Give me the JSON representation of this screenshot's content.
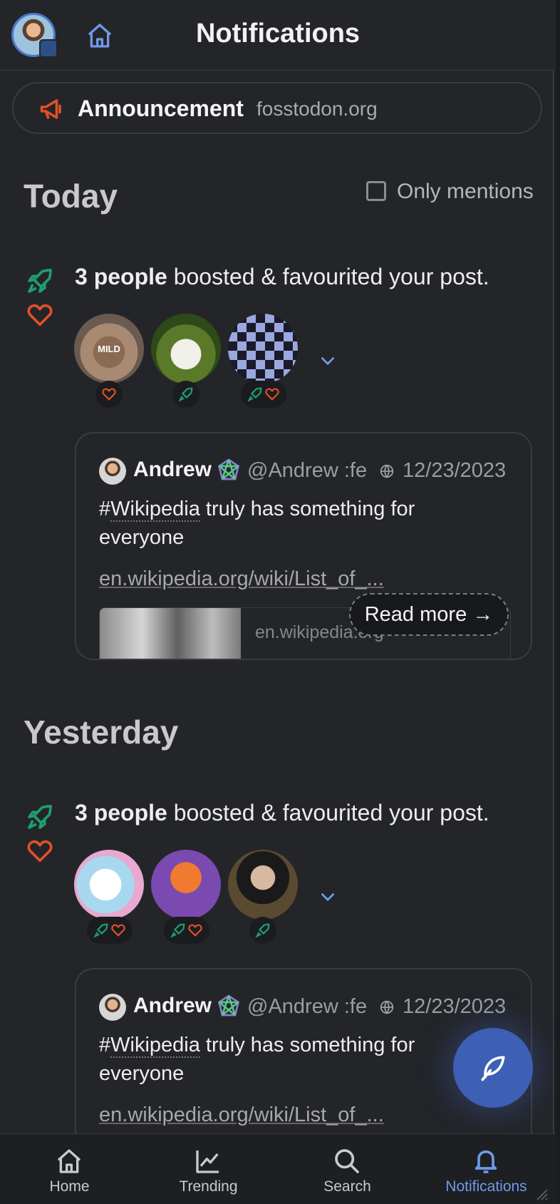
{
  "header": {
    "title": "Notifications"
  },
  "announcement": {
    "label": "Announcement",
    "domain": "fosstodon.org"
  },
  "sections": [
    {
      "heading": "Today",
      "filter_label": "Only mentions",
      "notification": {
        "count_bold": "3 people",
        "text": " boosted & favourited your post.",
        "post": {
          "author": "Andrew",
          "handle": "@Andrew :fe",
          "date": "12/23/2023",
          "body_hash": "#",
          "body_tag": "Wikipedia",
          "body_rest": " truly has something for everyone",
          "link": "en.wikipedia.org/wiki/List_of_...",
          "preview_domain": "en.wikipedia.org",
          "read_more": "Read more →"
        }
      }
    },
    {
      "heading": "Yesterday",
      "notification": {
        "count_bold": "3 people",
        "text": " boosted & favourited your post.",
        "post": {
          "author": "Andrew",
          "handle": "@Andrew :fe",
          "date": "12/23/2023",
          "body_hash": "#",
          "body_tag": "Wikipedia",
          "body_rest": " truly has something for everyone",
          "link": "en.wikipedia.org/wiki/List_of_..."
        }
      }
    }
  ],
  "avatar_overlay_text": "MILD",
  "tabs": [
    {
      "label": "Home",
      "icon": "home-icon"
    },
    {
      "label": "Trending",
      "icon": "trending-icon"
    },
    {
      "label": "Search",
      "icon": "search-icon"
    },
    {
      "label": "Notifications",
      "icon": "bell-icon",
      "active": true
    }
  ],
  "colors": {
    "background": "#242529",
    "accent_blue": "#6f9ae8",
    "boost_green": "#1f9e6e",
    "favourite_red": "#e0502a",
    "fab": "#3d5fb4"
  }
}
